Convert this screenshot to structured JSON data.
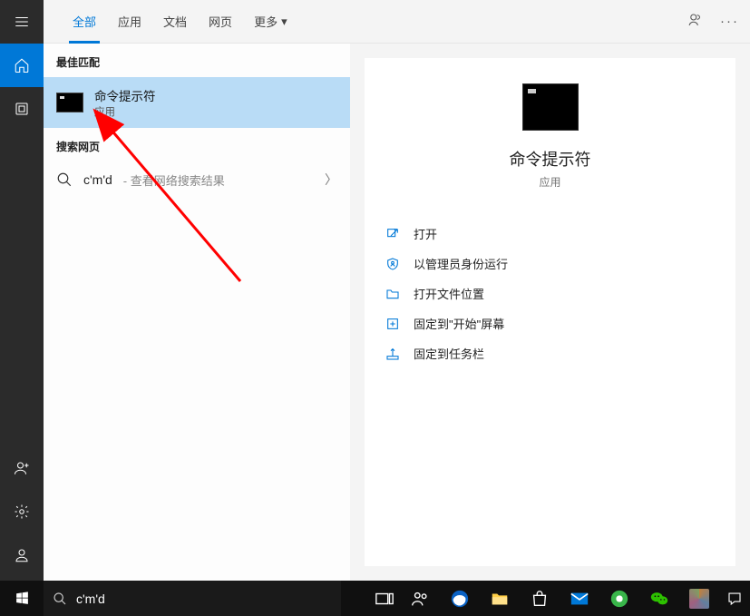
{
  "tabs": {
    "all": "全部",
    "apps": "应用",
    "docs": "文档",
    "web": "网页",
    "more": "更多"
  },
  "sections": {
    "best_match": "最佳匹配",
    "search_web": "搜索网页"
  },
  "best_match": {
    "title": "命令提示符",
    "subtitle": "应用"
  },
  "web_search": {
    "query": "c'm'd",
    "hint": "查看网络搜索结果"
  },
  "detail": {
    "title": "命令提示符",
    "subtitle": "应用",
    "actions": {
      "open": "打开",
      "run_admin": "以管理员身份运行",
      "open_loc": "打开文件位置",
      "pin_start": "固定到\"开始\"屏幕",
      "pin_taskbar": "固定到任务栏"
    }
  },
  "search_input": {
    "value": "c'm'd",
    "placeholder": ""
  },
  "colors": {
    "accent": "#0078d7",
    "highlight": "#b9dcf6"
  }
}
